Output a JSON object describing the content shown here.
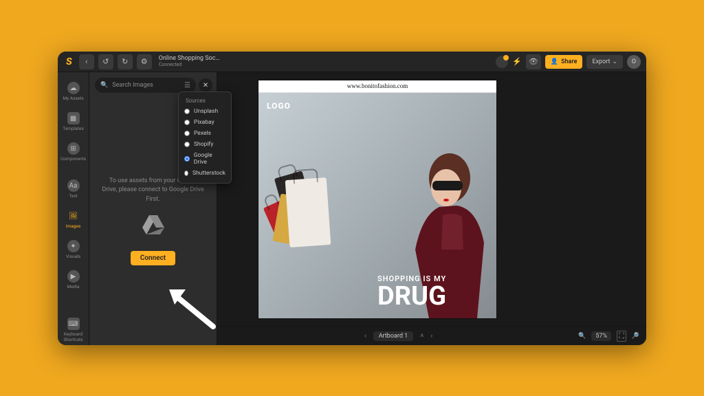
{
  "topbar": {
    "doc_title": "Online Shopping Soc…",
    "doc_status": "Connected",
    "share": "Share",
    "export": "Export",
    "avatar_initial": "O"
  },
  "rail": {
    "items": [
      {
        "label": "My Assets"
      },
      {
        "label": "Templates"
      },
      {
        "label": "Components"
      },
      {
        "label": "Text"
      },
      {
        "label": "Images"
      },
      {
        "label": "Visuals"
      },
      {
        "label": "Media"
      }
    ],
    "footer": {
      "label": "Keyboard Shortcuts"
    }
  },
  "panel": {
    "search_placeholder": "Search Images",
    "message": "To use assets from your Google Drive, please connect to Google Drive First.",
    "connect": "Connect"
  },
  "sources": {
    "title": "Sources",
    "items": [
      {
        "label": "Unsplash",
        "selected": false
      },
      {
        "label": "Pixabay",
        "selected": false
      },
      {
        "label": "Pexels",
        "selected": false
      },
      {
        "label": "Shopify",
        "selected": false
      },
      {
        "label": "Google Drive",
        "selected": true
      },
      {
        "label": "Shutterstock",
        "selected": false
      }
    ]
  },
  "artboard": {
    "url": "www.bonitofashion.com",
    "logo": "LOGO",
    "tagline_small": "SHOPPING IS MY",
    "tagline_big": "DRUG",
    "name": "Artboard 1"
  },
  "zoom": {
    "value": "57%"
  }
}
